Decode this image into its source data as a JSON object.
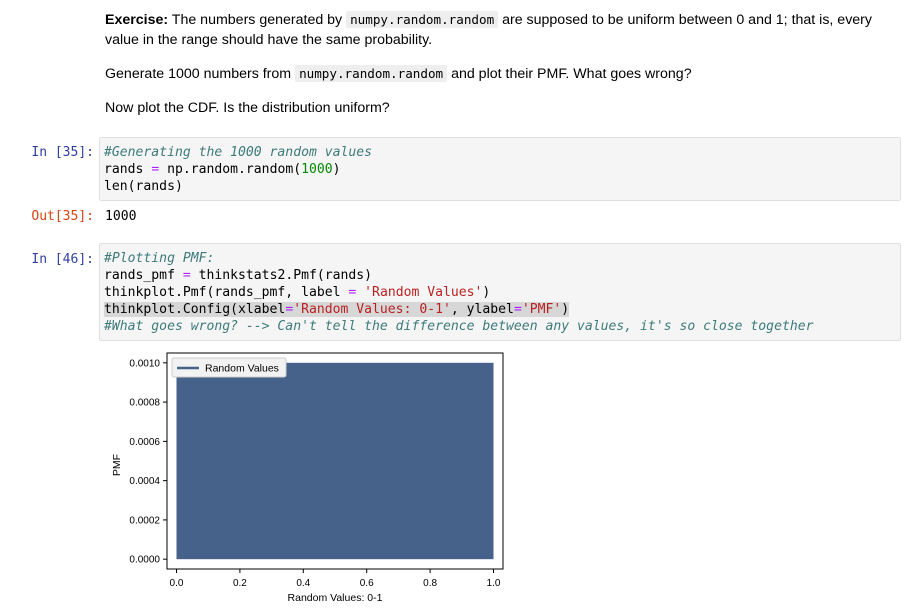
{
  "markdown": {
    "p1_bold": "Exercise:",
    "p1_a": " The numbers generated by ",
    "p1_code": "numpy.random.random",
    "p1_b": " are supposed to be uniform between 0 and 1; that is, every value in the range should have the same probability.",
    "p2_a": "Generate 1000 numbers from ",
    "p2_code": "numpy.random.random",
    "p2_b": " and plot their PMF. What goes wrong?",
    "p3": "Now plot the CDF. Is the distribution uniform?"
  },
  "cell35": {
    "prompt_in": "In [35]:",
    "line1": "#Generating the 1000 random values",
    "line2_a": "rands ",
    "line2_op": "=",
    "line2_b": " np.random.random(",
    "line2_num": "1000",
    "line2_c": ")",
    "line3": "len(rands)",
    "prompt_out": "Out[35]:",
    "output": "1000"
  },
  "cell46": {
    "prompt_in": "In [46]:",
    "line1": "#Plotting PMF:",
    "line2_a": "rands_pmf ",
    "line2_op": "=",
    "line2_b": " thinkstats2.Pmf(rands)",
    "line3_a": "thinkplot.Pmf(rands_pmf, label ",
    "line3_op": "=",
    "line3_sp": " ",
    "line3_str": "'Random Values'",
    "line3_c": ")",
    "line4_a": "thinkplot.Config(xlabel",
    "line4_op1": "=",
    "line4_str1": "'Random Values: 0-1'",
    "line4_b": ", ylabel",
    "line4_op2": "=",
    "line4_str2": "'PMF'",
    "line4_c": ")",
    "line5": "#What goes wrong? --> Can't tell the difference between any values, it's so close together"
  },
  "chart_data": {
    "type": "bar",
    "series": [
      {
        "name": "Random Values",
        "color": "#46618a"
      }
    ],
    "x_range": [
      0.0,
      1.0
    ],
    "y_value": 0.001,
    "xlim": [
      -0.03,
      1.03
    ],
    "ylim": [
      -5e-05,
      0.00105
    ],
    "xticks": [
      "0.0",
      "0.2",
      "0.4",
      "0.6",
      "0.8",
      "1.0"
    ],
    "xtick_values": [
      0.0,
      0.2,
      0.4,
      0.6,
      0.8,
      1.0
    ],
    "yticks": [
      "0.0000",
      "0.0002",
      "0.0004",
      "0.0006",
      "0.0008",
      "0.0010"
    ],
    "ytick_values": [
      0.0,
      0.0002,
      0.0004,
      0.0006,
      0.0008,
      0.001
    ],
    "xlabel": "Random Values: 0-1",
    "ylabel": "PMF",
    "legend": "top-left",
    "grid": false
  }
}
